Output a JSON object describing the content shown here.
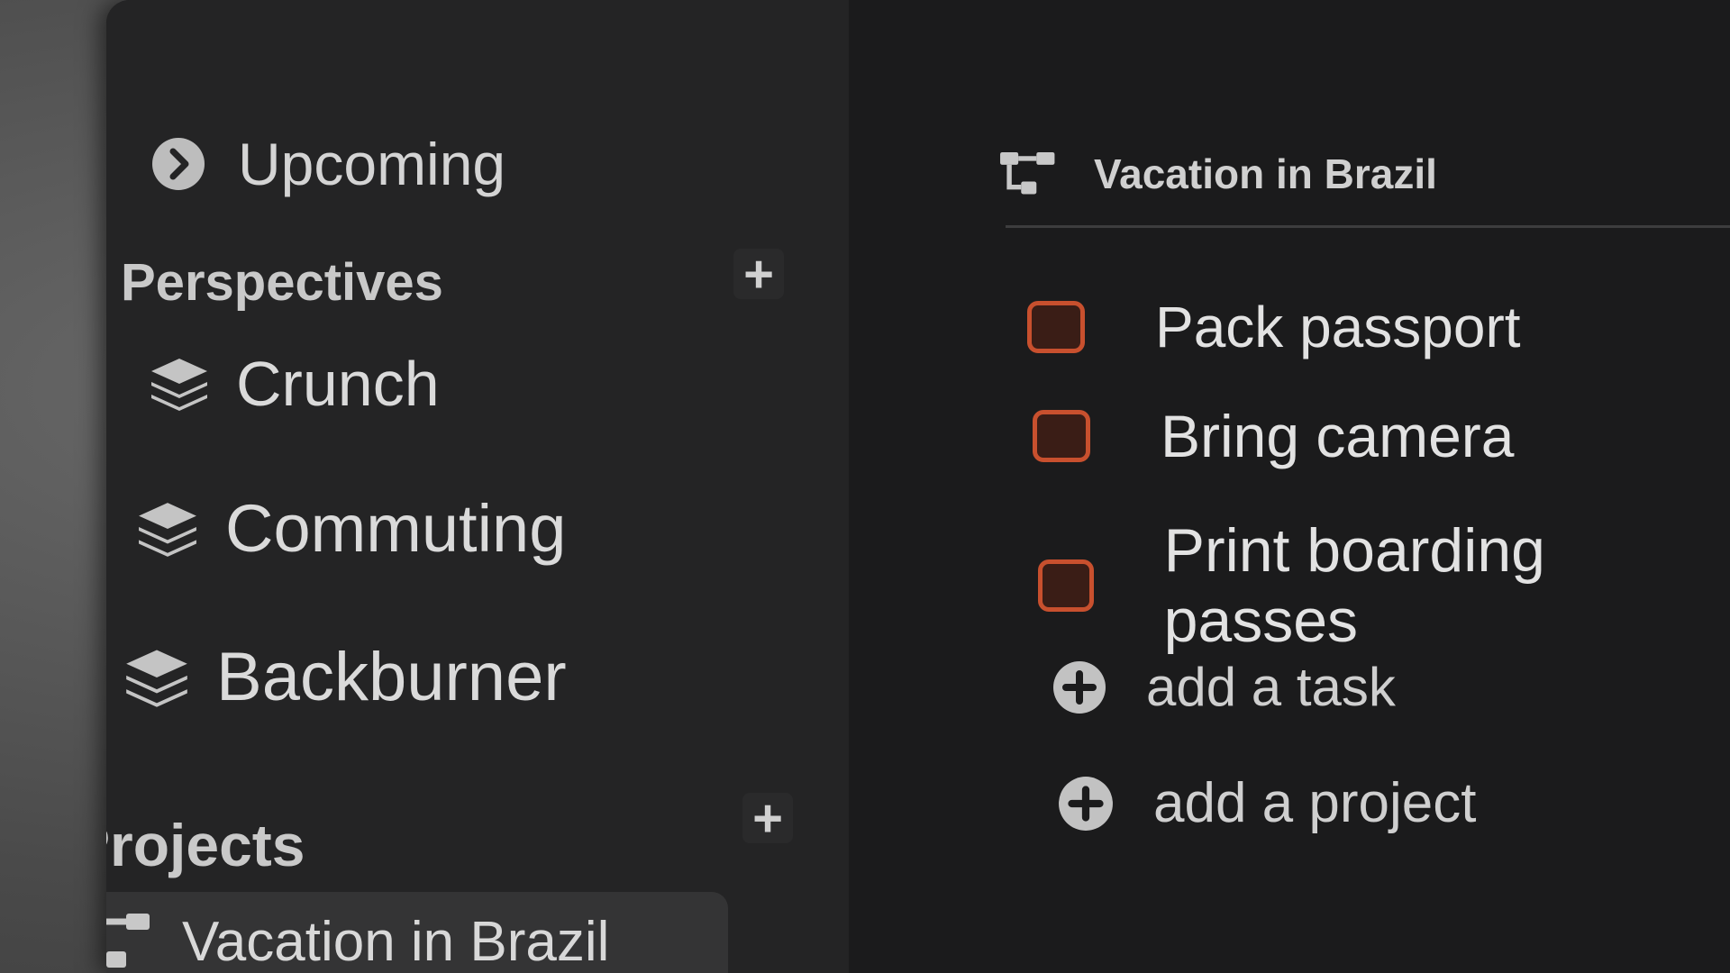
{
  "window": {
    "traffic_lights": [
      "close",
      "minimize",
      "zoom"
    ],
    "colors": {
      "close": "#e0593c",
      "minimize": "#d6b23a",
      "zoom": "#4caf3e"
    }
  },
  "sidebar": {
    "upcoming": {
      "label": "Upcoming",
      "icon": "chevron-right-circle-icon"
    },
    "perspectives": {
      "heading": "Perspectives",
      "add_icon": "plus-icon",
      "items": [
        {
          "label": "Crunch",
          "icon": "layers-icon"
        },
        {
          "label": "Commuting",
          "icon": "layers-icon"
        },
        {
          "label": "Backburner",
          "icon": "layers-icon"
        }
      ]
    },
    "projects": {
      "heading": "Projects",
      "add_icon": "plus-icon",
      "items": [
        {
          "label": "Vacation in Brazil",
          "icon": "project-tree-icon",
          "selected": true
        }
      ]
    }
  },
  "main": {
    "project_title": "Vacation in Brazil",
    "project_icon": "project-tree-icon",
    "tasks": [
      {
        "label": "Pack passport",
        "checked": false
      },
      {
        "label": "Bring camera",
        "checked": false
      },
      {
        "label": "Print boarding passes",
        "checked": false
      }
    ],
    "add_task_label": "add a task",
    "add_project_label": "add a project",
    "checkbox_color": "#c8502e"
  }
}
